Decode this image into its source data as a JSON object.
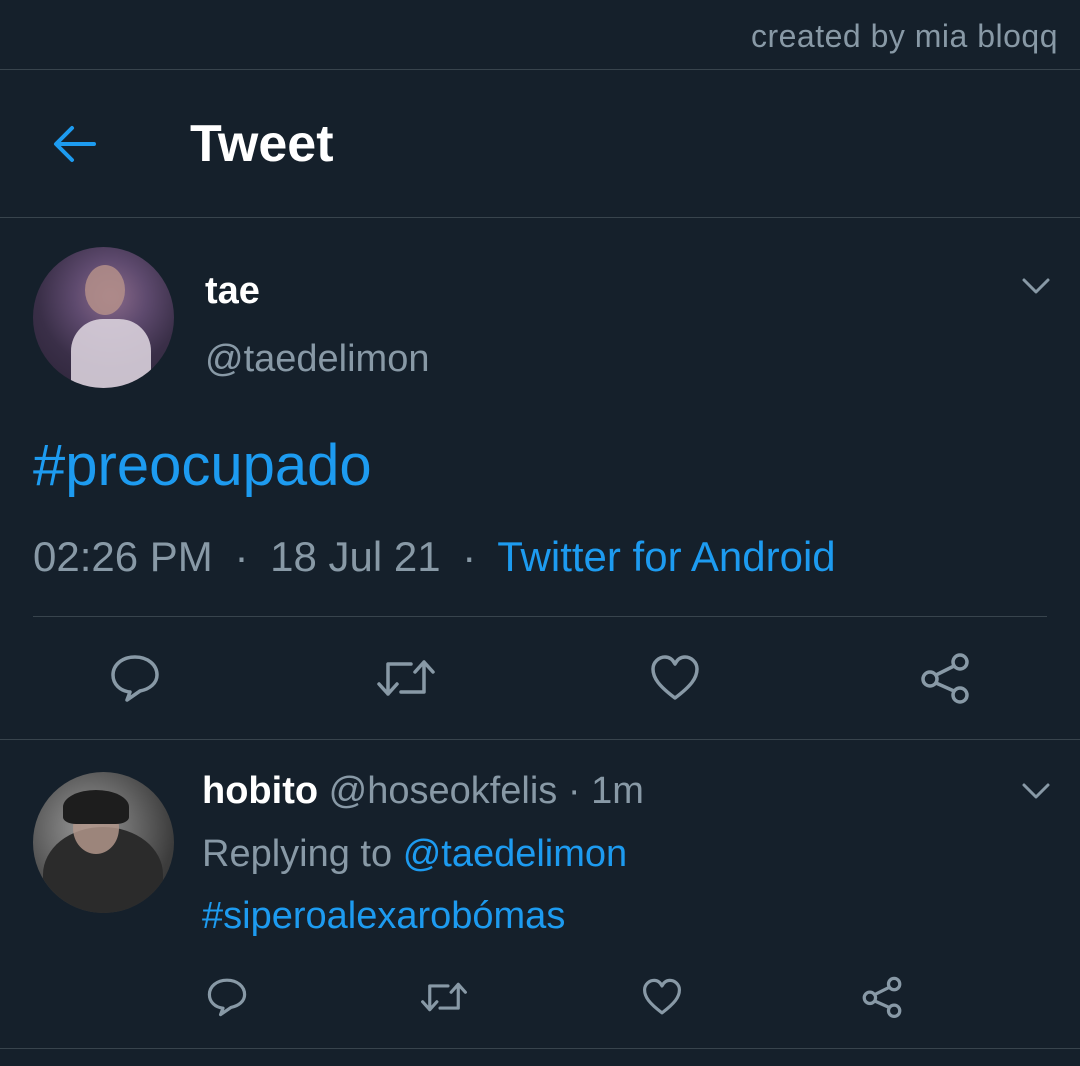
{
  "watermark": "created by mia bloqq",
  "header": {
    "title": "Tweet",
    "back_icon": "arrow-left-icon"
  },
  "tweet": {
    "name": "tae",
    "handle": "@taedelimon",
    "text": "#preocupado",
    "time": "02:26 PM",
    "date": "18 Jul 21",
    "separator": "·",
    "source": "Twitter for Android"
  },
  "reply": {
    "name": "hobito",
    "handle": "@hoseokfelis",
    "separator": "·",
    "age": "1m",
    "replying_prefix": "Replying to",
    "replying_to": "@taedelimon",
    "text": "#siperoalexarobómas"
  },
  "colors": {
    "background": "#15202b",
    "accent": "#1d9bf0",
    "muted": "#8899a6",
    "divider": "#38444d"
  }
}
